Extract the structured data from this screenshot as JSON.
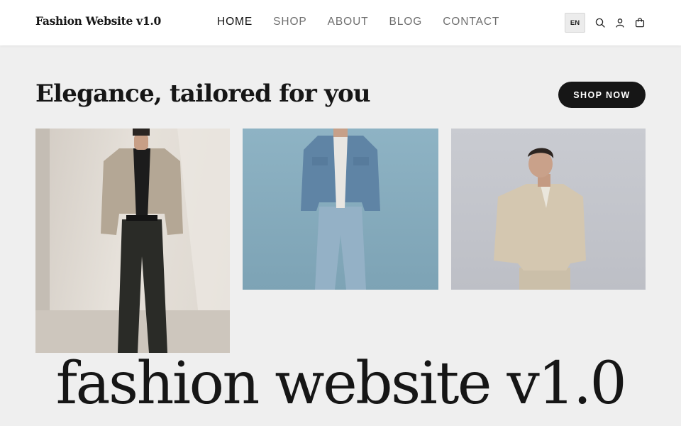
{
  "header": {
    "logo": "Fashion Website v1.0",
    "nav": [
      "HOME",
      "SHOP",
      "ABOUT",
      "BLOG",
      "CONTACT"
    ],
    "language": "EN",
    "icons": [
      "search-icon",
      "user-icon",
      "cart-icon"
    ]
  },
  "hero": {
    "headline": "Elegance, tailored for you",
    "cta": "SHOP NOW"
  },
  "gallery": [
    "man-beige-jacket-black-trousers",
    "man-denim-jacket-jeans",
    "man-beige-shirt-against-wall"
  ],
  "footer_brand": "fashion website v1.0",
  "colors": {
    "accent": "#161616",
    "background": "#efefef",
    "header": "#ffffff"
  }
}
